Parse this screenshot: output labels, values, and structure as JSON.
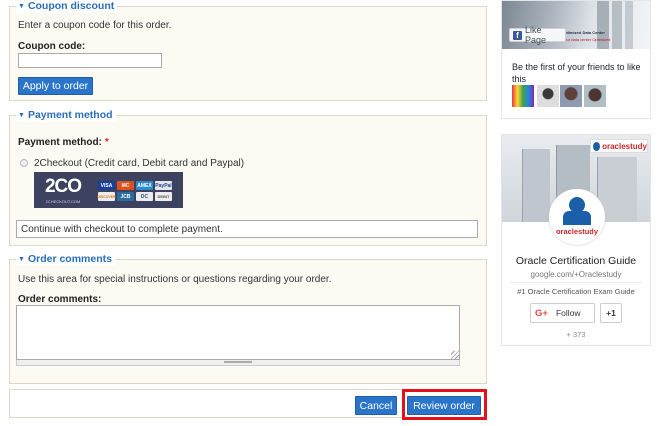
{
  "coupon": {
    "legend": "Coupon discount",
    "description": "Enter a coupon code for this order.",
    "field_label": "Coupon code:",
    "field_value": "",
    "button": "Apply to order"
  },
  "payment": {
    "legend": "Payment method",
    "field_label": "Payment method:",
    "required_mark": "*",
    "option_label": "2Checkout (Credit card, Debit card and Paypal)",
    "logo_text": "2CO",
    "logo_sub": "2CHECKOUT.COM",
    "cards": [
      "VISA",
      "MC",
      "AMEX",
      "PayPal",
      "DISCOVER",
      "JCB",
      "DC",
      "DEBIT"
    ],
    "message": "Continue with checkout to complete payment."
  },
  "comments": {
    "legend": "Order comments",
    "description": "Use this area for special instructions or questions regarding your order.",
    "field_label": "Order comments:",
    "field_value": ""
  },
  "actions": {
    "cancel": "Cancel",
    "review": "Review order"
  },
  "facebook_widget": {
    "banner_line1": "Optimized Data Center",
    "banner_line2": "Your data center Optimized",
    "like_page": "Like Page",
    "friends_text": "Be the first of your friends to like this"
  },
  "gplus_widget": {
    "banner_brand": "oraclestudy",
    "avatar_brand": "oraclestudy",
    "name": "Oracle Certification Guide",
    "url": "google.com/+Oraclestudy",
    "tagline": "#1 Oracle Certification Exam Guide",
    "follow": "Follow",
    "plus_one": "+1",
    "count": "+ 373"
  },
  "colors": {
    "accent": "#2a75c9",
    "legend": "#2a6ebb",
    "highlight": "#e5101a",
    "fieldset_bg": "#fbfaf3",
    "gplus_red": "#dd4b39"
  }
}
